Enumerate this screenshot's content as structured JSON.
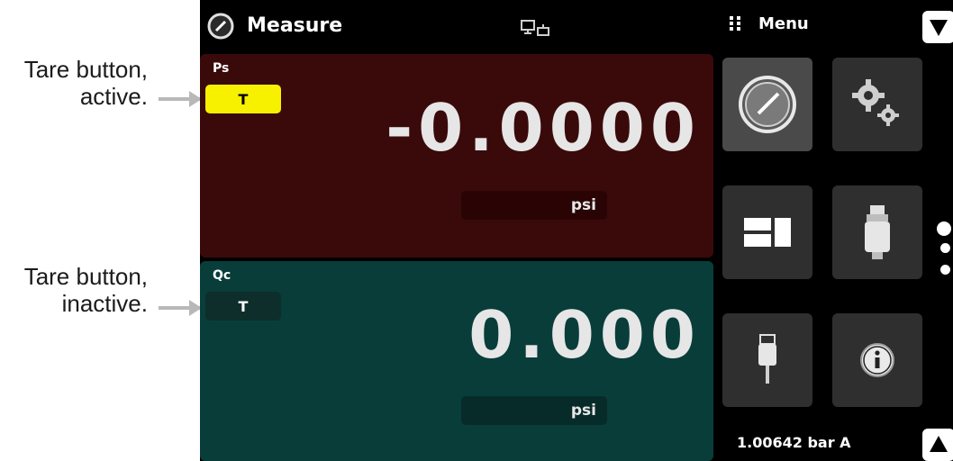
{
  "callouts": {
    "active": [
      "Tare button,",
      "active."
    ],
    "inactive": [
      "Tare button,",
      "inactive."
    ]
  },
  "header": {
    "title": "Measure",
    "menu_label": "Menu"
  },
  "channels": [
    {
      "label": "Ps",
      "tare_label": "T",
      "tare_state": "active",
      "reading": "-0.0000",
      "unit": "psi"
    },
    {
      "label": "Qc",
      "tare_label": "T",
      "tare_state": "inactive",
      "reading": "0.000",
      "unit": "psi"
    }
  ],
  "menu_tiles": [
    {
      "icon": "gauge-icon",
      "selected": true
    },
    {
      "icon": "settings-gears-icon",
      "selected": false
    },
    {
      "icon": "display-layout-icon",
      "selected": false
    },
    {
      "icon": "transducer-icon",
      "selected": false
    },
    {
      "icon": "usb-icon",
      "selected": false
    },
    {
      "icon": "info-icon",
      "selected": false
    }
  ],
  "status": {
    "barometer": "1.00642 bar A"
  },
  "colors": {
    "ps_panel": "#3a0a0b",
    "qc_panel": "#083d3a",
    "tare_active": "#f7f100",
    "tile_bg": "#2f2f2f"
  }
}
